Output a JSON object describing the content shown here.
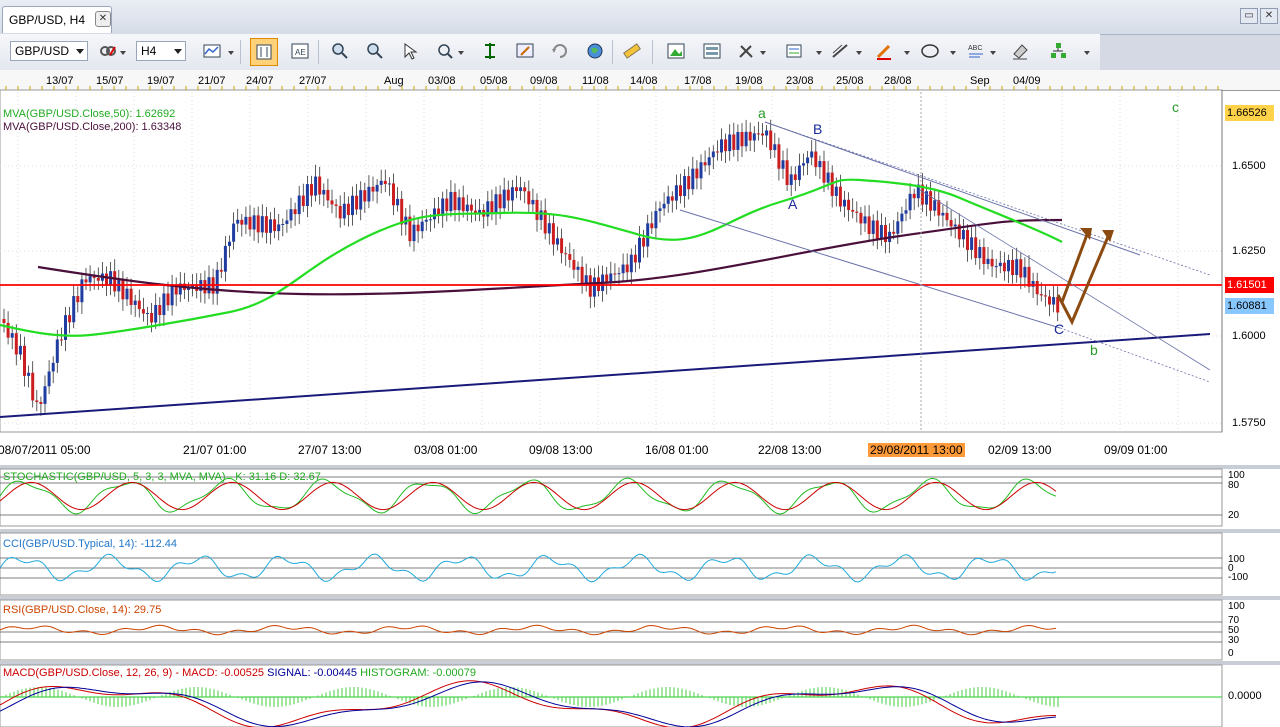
{
  "tab": {
    "title": "GBP/USD, H4",
    "close": "✕"
  },
  "window": {
    "restore": "▭",
    "close": "✕"
  },
  "toolbar": {
    "symbol": "GBP/USD",
    "timeframe": "H4"
  },
  "top_dates": [
    "13/07",
    "15/07",
    "19/07",
    "21/07",
    "24/07",
    "27/07",
    "Aug",
    "03/08",
    "05/08",
    "09/08",
    "11/08",
    "14/08",
    "17/08",
    "19/08",
    "23/08",
    "25/08",
    "28/08",
    "Sep",
    "04/09"
  ],
  "main_chart": {
    "mva50_label": "MVA(GBP/USD.Close,50): 1.62692",
    "mva200_label": "MVA(GBP/USD.Close,200): 1.63348",
    "price_ticks": [
      "1.6500",
      "1.6250",
      "1.6000",
      "1.5750"
    ],
    "price_box_top": "1.66526",
    "price_box_red": "1.61501",
    "price_box_current": "1.60881",
    "time_labels": [
      "08/07/2011 05:00",
      "21/07 01:00",
      "27/07 13:00",
      "03/08 01:00",
      "09/08 13:00",
      "16/08 01:00",
      "22/08 13:00",
      "29/08/2011 13:00",
      "02/09 13:00",
      "09/09 01:00"
    ],
    "wave_labels": {
      "a": "a",
      "B": "B",
      "A": "A",
      "C": "C",
      "b": "b",
      "c": "c"
    },
    "colors": {
      "mva50": "#22dd22",
      "mva200": "#4a0f3a",
      "support": "#ff0000",
      "trend": "#1a1a7a",
      "arrow": "#8b4a0f"
    }
  },
  "stochastic": {
    "label": "STOCHASTIC(GBP/USD, 5, 3, 3, MVA, MVA) -  K: 31.16  D: 32.67",
    "ticks": [
      "100",
      "80",
      "20"
    ]
  },
  "cci": {
    "label": "CCI(GBP/USD.Typical, 14): -112.44",
    "ticks": [
      "100",
      "0",
      "-100"
    ]
  },
  "rsi": {
    "label": "RSI(GBP/USD.Close, 14): 29.75",
    "ticks": [
      "100",
      "70",
      "50",
      "30",
      "0"
    ]
  },
  "macd": {
    "label_prefix": "MACD(GBP/USD.Close, 12, 26, 9) -",
    "macd_value": "MACD: -0.00525",
    "signal": "SIGNAL: -0.00445",
    "histogram": "HISTOGRAM: -0.00079",
    "tick": "0.0000"
  }
}
